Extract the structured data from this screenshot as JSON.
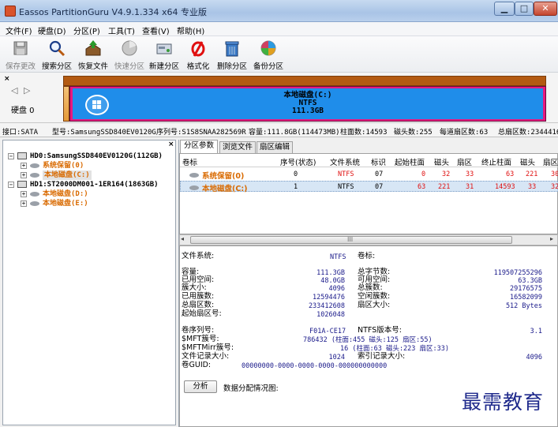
{
  "window": {
    "title": "Eassos PartitionGuru V4.9.1.334 x64 专业版",
    "minimize": "▁",
    "maximize": "□",
    "close": "✕"
  },
  "menu": [
    "文件(F)",
    "硬盘(D)",
    "分区(P)",
    "工具(T)",
    "查看(V)",
    "帮助(H)"
  ],
  "toolbar": [
    {
      "label": "保存更改",
      "icon": "save-icon",
      "disabled": true
    },
    {
      "label": "搜索分区",
      "icon": "search-icon",
      "disabled": false
    },
    {
      "label": "恢复文件",
      "icon": "recover-files-icon",
      "disabled": false
    },
    {
      "label": "快速分区",
      "icon": "quick-partition-icon",
      "disabled": true
    },
    {
      "label": "新建分区",
      "icon": "new-partition-icon",
      "disabled": false
    },
    {
      "label": "格式化",
      "icon": "format-icon",
      "disabled": false
    },
    {
      "label": "删除分区",
      "icon": "delete-partition-icon",
      "disabled": false
    },
    {
      "label": "备份分区",
      "icon": "backup-partition-icon",
      "disabled": false
    }
  ],
  "disk_panel": {
    "close": "×",
    "arrows": "◁ ▷",
    "disk_label": "硬盘 0",
    "partition_name": "本地磁盘(C:)",
    "partition_fs": "NTFS",
    "partition_size": "111.3GB"
  },
  "info_line": [
    "接口:SATA",
    "型号:SamsungSSD840EV0120G",
    "序列号:S1S8SNAA282569R",
    "容量:111.8GB(114473MB)",
    "柱面数:14593",
    "磁头数:255",
    "每道扇区数:63",
    "总扇区数:2344416"
  ],
  "tree": {
    "close": "×",
    "items": [
      {
        "label": "HD0:SamsungSSD840EV0120G(112GB)",
        "level": 0,
        "expander": "−",
        "color": "black",
        "selected": false
      },
      {
        "label": "系统保留(0)",
        "level": 1,
        "expander": "+",
        "color": "orange",
        "selected": false
      },
      {
        "label": "本地磁盘(C:)",
        "level": 1,
        "expander": "+",
        "color": "orange",
        "selected": true
      },
      {
        "label": "HD1:ST2000DM001-1ER164(1863GB)",
        "level": 0,
        "expander": "−",
        "color": "black",
        "selected": false
      },
      {
        "label": "本地磁盘(D:)",
        "level": 1,
        "expander": "+",
        "color": "orange",
        "selected": false
      },
      {
        "label": "本地磁盘(E:)",
        "level": 1,
        "expander": "+",
        "color": "orange",
        "selected": false
      }
    ]
  },
  "tabs": [
    "分区参数",
    "浏览文件",
    "扇区编辑"
  ],
  "partition_table": {
    "headers": [
      "卷标",
      "序号(状态)",
      "文件系统",
      "标识",
      "起始柱面",
      "磁头",
      "扇区",
      "终止柱面",
      "磁头",
      "扇区"
    ],
    "rows": [
      [
        "系统保留(0)",
        "0",
        "NTFS",
        "07",
        "0",
        "32",
        "33",
        "63",
        "221",
        "30"
      ],
      [
        "本地磁盘(C:)",
        "1",
        "NTFS",
        "07",
        "63",
        "221",
        "31",
        "14593",
        "33",
        "32"
      ]
    ]
  },
  "scrollbar": {
    "left": "◂",
    "right": "▸",
    "grip": "III"
  },
  "details": {
    "fs_label": "文件系统:",
    "fs_value": "NTFS",
    "vol_label": "卷标:",
    "left_labels": [
      "容量:",
      "已用空间:",
      "簇大小:",
      "已用簇数:",
      "总扇区数:",
      "起始扇区号:"
    ],
    "left_values": [
      "111.3GB",
      "48.0GB",
      "4096",
      "12594476",
      "233412608",
      "1026048"
    ],
    "right_labels": [
      "总字节数:",
      "可用空间:",
      "总簇数:",
      "空闲簇数:",
      "扇区大小:"
    ],
    "right_values": [
      "119507255296",
      "63.3GB",
      "29176575",
      "16582099",
      "512 Bytes"
    ],
    "serial_label": "卷序列号:",
    "serial_value": "F01A-CE17",
    "ntfs_ver_label": "NTFS版本号:",
    "ntfs_ver_value": "3.1",
    "mft_label": "$MFT簇号:",
    "mft_value": "786432 (柱面:455 磁头:125 扇区:55)",
    "mftmirr_label": "$MFTMirr簇号:",
    "mftmirr_value": "16 (柱面:63 磁头:223 扇区:33)",
    "record_label": "文件记录大小:",
    "record_value": "1024",
    "index_label": "索引记录大小:",
    "index_value": "4096",
    "guid_label": "卷GUID:",
    "guid_value": "00000000-0000-0000-0000-000000000000",
    "analyze_button": "分析",
    "analyze_label": "数据分配情况图:"
  },
  "watermark": "最需教育"
}
